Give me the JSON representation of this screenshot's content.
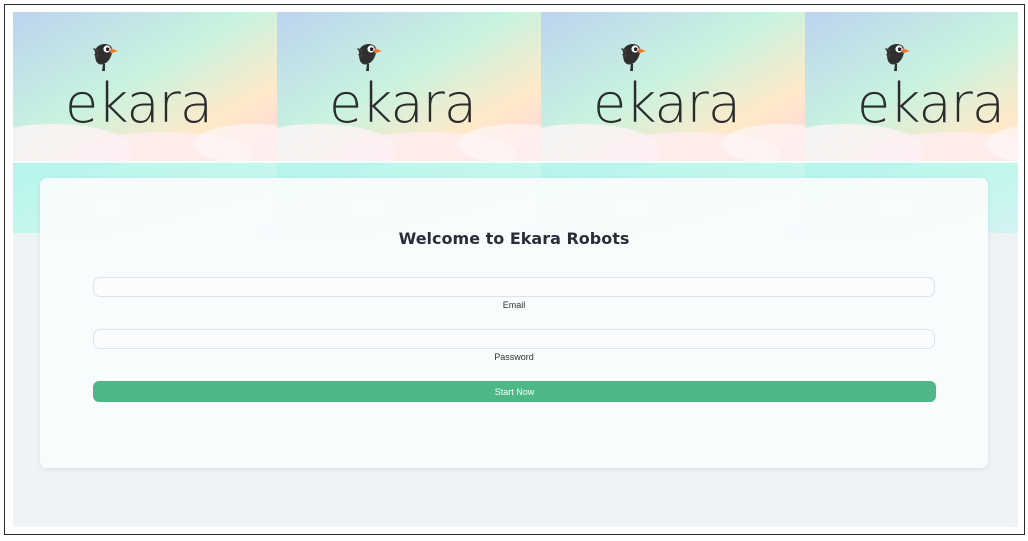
{
  "banner": {
    "logo_text": "ekara",
    "tile_count": 4
  },
  "login": {
    "title": "Welcome to Ekara Robots",
    "email_label": "Email",
    "email_value": "",
    "password_label": "Password",
    "password_value": "",
    "submit_label": "Start Now"
  },
  "colors": {
    "accent": "#4db785",
    "page_background": "#eef3f5",
    "card_background": "#fafcfd",
    "title_text": "#2d2d3a",
    "logo_text": "#2b2b2b",
    "bird_beak": "#f07a2a"
  },
  "icons": {
    "logo_mark": "bird-icon"
  }
}
